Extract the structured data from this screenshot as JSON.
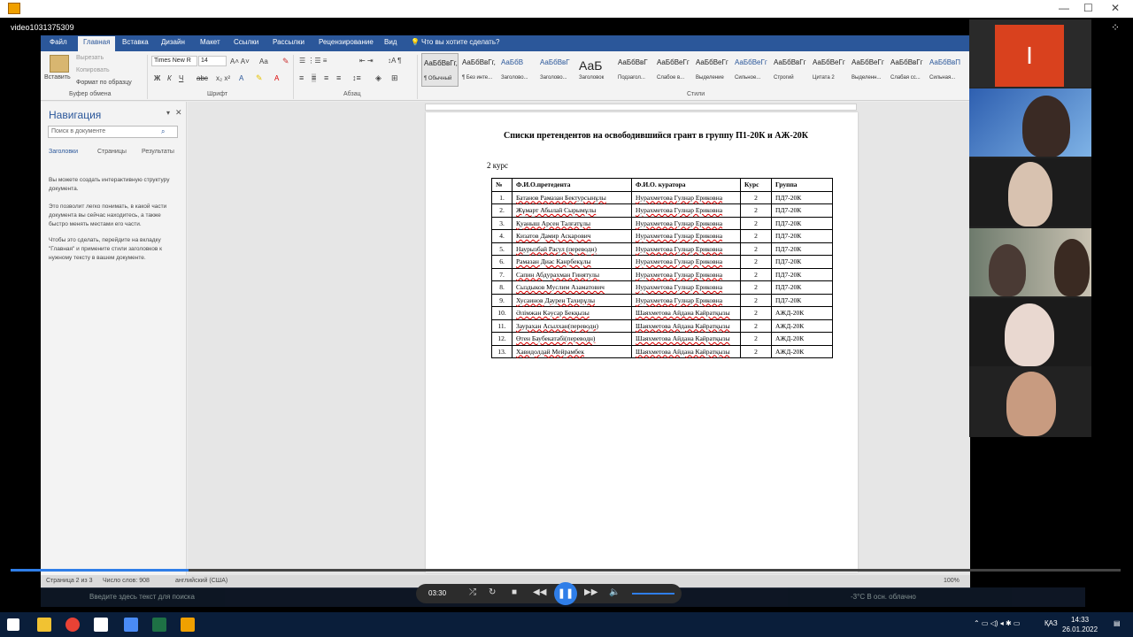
{
  "window": {
    "title": "video1031375309"
  },
  "word": {
    "tabs": [
      "Файл",
      "Главная",
      "Вставка",
      "Дизайн",
      "Макет",
      "Ссылки",
      "Рассылки",
      "Рецензирование",
      "Вид"
    ],
    "active_tab": "Главная",
    "tell_me": "Что вы хотите сделать?",
    "clipboard": {
      "paste": "Вставить",
      "cut": "Вырезать",
      "copy": "Копировать",
      "format_painter": "Формат по образцу",
      "label": "Буфер обмена"
    },
    "font": {
      "name": "Times New R",
      "size": "14",
      "label": "Шрифт"
    },
    "paragraph_label": "Абзац",
    "styles_label": "Стили",
    "styles": [
      {
        "sample": "АаБбВвГг,",
        "name": "¶ Обычный"
      },
      {
        "sample": "АаБбВвГг,",
        "name": "¶ Без инте..."
      },
      {
        "sample": "АаБбВ",
        "name": "Заголово..."
      },
      {
        "sample": "АаБбВвГ",
        "name": "Заголово..."
      },
      {
        "sample": "АаБ",
        "name": "Заголовок"
      },
      {
        "sample": "АаБбВвГ",
        "name": "Подзагол..."
      },
      {
        "sample": "АаБбВеГг",
        "name": "Слабое в..."
      },
      {
        "sample": "АаБбВеГг",
        "name": "Выделение"
      },
      {
        "sample": "АаБбВеГг",
        "name": "Сильное..."
      },
      {
        "sample": "АаБбВвГг",
        "name": "Строгий"
      },
      {
        "sample": "АаБбВеГг",
        "name": "Цитата 2"
      },
      {
        "sample": "АаБбВеГг",
        "name": "Выделенн..."
      },
      {
        "sample": "АаБбВвГг",
        "name": "Слабая сс..."
      },
      {
        "sample": "АаБбВвП",
        "name": "Сильная..."
      }
    ],
    "nav": {
      "title": "Навигация",
      "search_placeholder": "Поиск в документе",
      "tabs": [
        "Заголовки",
        "Страницы",
        "Результаты"
      ],
      "p1": "Вы можете создать интерактивную структуру документа.",
      "p2": "Это позволит легко понимать, в какой части документа вы сейчас находитесь, а также быстро менять местами его части.",
      "p3": "Чтобы это сделать, перейдите на вкладку \"Главная\" и примените стили заголовков к нужному тексту в вашем документе."
    },
    "status": {
      "page": "Страница 2 из 3",
      "words": "Число слов: 908",
      "lang": "английский (США)",
      "zoom": "100%"
    }
  },
  "document": {
    "title": "Списки претендентов на освободившийся грант в группу П1-20К и АЖ-20К",
    "subtitle": "2 курс",
    "headers": [
      "№",
      "Ф.И.О.претедента",
      "Ф.И.О. куратора",
      "Курс",
      "Группа"
    ],
    "rows": [
      {
        "no": "1.",
        "name": "Батанов Рамазан Бектурсынұлы",
        "curator": "Нурахметова Гулнар Ериковна",
        "course": "2",
        "group": "ПД7-20К"
      },
      {
        "no": "2.",
        "name": "Жұмарт Абылай Сырымұлы",
        "curator": "Нурахметова Гулнар Ериковна",
        "course": "2",
        "group": "ПД7-20К"
      },
      {
        "no": "3.",
        "name": "Қуаныш Арсен Талғатұлы",
        "curator": "Нурахметова Гулнар Ериковна",
        "course": "2",
        "group": "ПД7-20К"
      },
      {
        "no": "4.",
        "name": "Кизатов Дамир Аскарович",
        "curator": "Нурахметова Гулнар Ериковна",
        "course": "2",
        "group": "ПД7-20К"
      },
      {
        "no": "5.",
        "name": "Наурызбай Расул (переводн)",
        "curator": "Нурахметова Гулнар Ериковна",
        "course": "2",
        "group": "ПД7-20К"
      },
      {
        "no": "6.",
        "name": "Рамазан Диас Канрбекұлы",
        "curator": "Нурахметова Гулнар Ериковна",
        "course": "2",
        "group": "ПД7-20К"
      },
      {
        "no": "7.",
        "name": "Сапин Абдурахман Гинятулы",
        "curator": "Нурахметова Гулнар Ериковна",
        "course": "2",
        "group": "ПД7-20К"
      },
      {
        "no": "8.",
        "name": "Сыздыков Муслим Азаматович",
        "curator": "Нурахметова Гулнар Ериковна",
        "course": "2",
        "group": "ПД7-20К"
      },
      {
        "no": "9.",
        "name": "Хусаинов Даурен Тахирұлы",
        "curator": "Нурахметова Гулнар Ериковна",
        "course": "2",
        "group": "ПД7-20К"
      },
      {
        "no": "10.",
        "name": "Әлімжан Кәусар Бекқызы",
        "curator": "Шаяхметова Айдана Кайратқызы",
        "course": "2",
        "group": "АЖД-20К"
      },
      {
        "no": "11.",
        "name": "Заурахан Асылхан(переводн)",
        "curator": "Шаяхметова Айдана Кайратқызы",
        "course": "2",
        "group": "АЖД-20К"
      },
      {
        "no": "12.",
        "name": "Өтен Баубекатабі(переводн)",
        "curator": "Шаяхметова Айдана Кайратқызы",
        "course": "2",
        "group": "АЖД-20К"
      },
      {
        "no": "13.",
        "name": "Хавидолдай Мейрамбек",
        "curator": "Шаяхметова Айдана Кайратқызы",
        "course": "2",
        "group": "АЖД-20К"
      }
    ]
  },
  "participants": {
    "first_initial": "I"
  },
  "player": {
    "time": "03:30",
    "progress": 0.16
  },
  "inner_taskbar": {
    "search": "Введите здесь текст для поиска",
    "weather": "-3°C  В осн. облачно"
  },
  "taskbar": {
    "lang": "ҚАЗ",
    "time": "14:33",
    "date": "26.01.2022"
  }
}
